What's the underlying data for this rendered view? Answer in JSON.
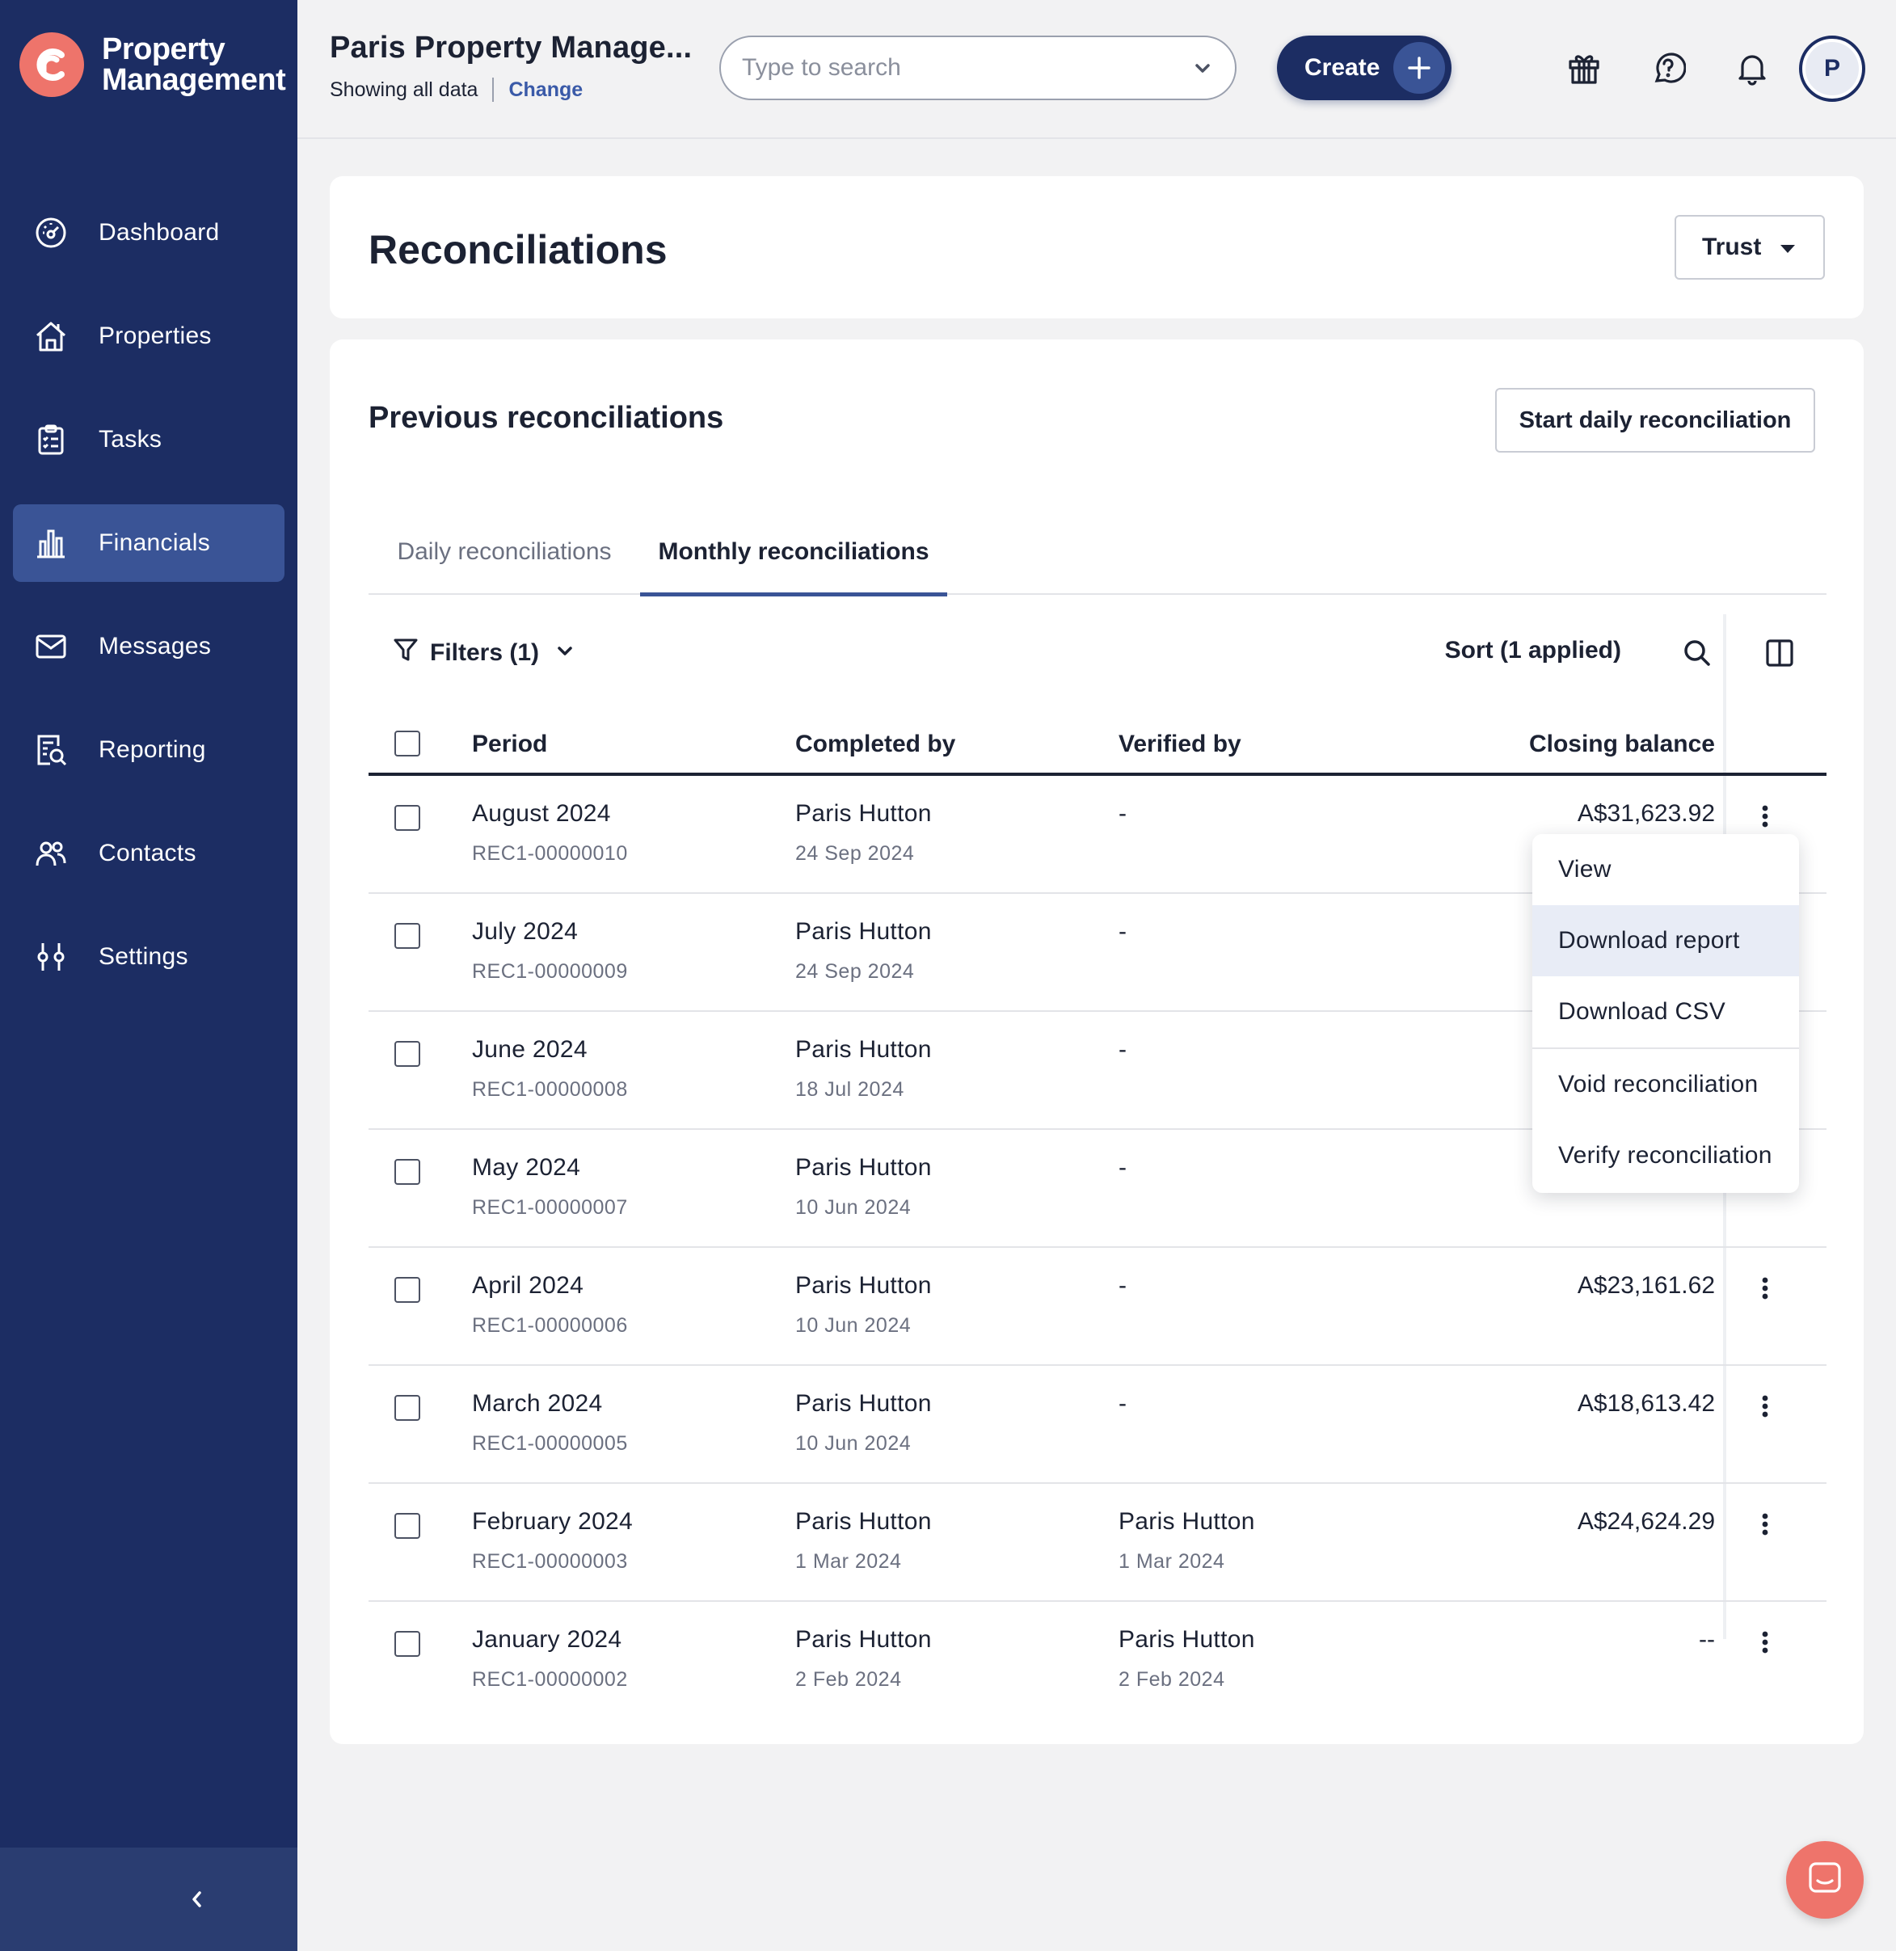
{
  "brand": {
    "line1": "Property",
    "line2": "Management"
  },
  "nav": [
    {
      "label": "Dashboard",
      "icon": "dashboard-icon"
    },
    {
      "label": "Properties",
      "icon": "home-icon"
    },
    {
      "label": "Tasks",
      "icon": "clipboard-icon"
    },
    {
      "label": "Financials",
      "icon": "financials-icon",
      "active": true
    },
    {
      "label": "Messages",
      "icon": "envelope-icon"
    },
    {
      "label": "Reporting",
      "icon": "report-search-icon"
    },
    {
      "label": "Contacts",
      "icon": "users-icon"
    },
    {
      "label": "Settings",
      "icon": "sliders-icon"
    }
  ],
  "header": {
    "org_title": "Paris Property Manage...",
    "showing": "Showing all data",
    "change": "Change",
    "search_placeholder": "Type to search",
    "create": "Create",
    "avatar_initial": "P"
  },
  "page": {
    "title": "Reconciliations",
    "trust": "Trust",
    "section_title": "Previous reconciliations",
    "start_button": "Start daily reconciliation",
    "tabs": [
      "Daily reconciliations",
      "Monthly reconciliations"
    ],
    "filters": "Filters (1)",
    "sort": "Sort (1 applied)"
  },
  "table": {
    "columns": [
      "Period",
      "Completed by",
      "Verified by",
      "Closing balance"
    ],
    "rows": [
      {
        "period": "August 2024",
        "ref": "REC1-00000010",
        "completed_by": "Paris Hutton",
        "completed_date": "24 Sep 2024",
        "verified_by": "-",
        "verified_date": "",
        "balance": "A$31,623.92"
      },
      {
        "period": "July 2024",
        "ref": "REC1-00000009",
        "completed_by": "Paris Hutton",
        "completed_date": "24 Sep 2024",
        "verified_by": "-",
        "verified_date": "",
        "balance": ""
      },
      {
        "period": "June 2024",
        "ref": "REC1-00000008",
        "completed_by": "Paris Hutton",
        "completed_date": "18 Jul 2024",
        "verified_by": "-",
        "verified_date": "",
        "balance": ""
      },
      {
        "period": "May 2024",
        "ref": "REC1-00000007",
        "completed_by": "Paris Hutton",
        "completed_date": "10 Jun 2024",
        "verified_by": "-",
        "verified_date": "",
        "balance": ""
      },
      {
        "period": "April 2024",
        "ref": "REC1-00000006",
        "completed_by": "Paris Hutton",
        "completed_date": "10 Jun 2024",
        "verified_by": "-",
        "verified_date": "",
        "balance": "A$23,161.62"
      },
      {
        "period": "March 2024",
        "ref": "REC1-00000005",
        "completed_by": "Paris Hutton",
        "completed_date": "10 Jun 2024",
        "verified_by": "-",
        "verified_date": "",
        "balance": "A$18,613.42"
      },
      {
        "period": "February 2024",
        "ref": "REC1-00000003",
        "completed_by": "Paris Hutton",
        "completed_date": "1 Mar 2024",
        "verified_by": "Paris Hutton",
        "verified_date": "1 Mar 2024",
        "balance": "A$24,624.29"
      },
      {
        "period": "January 2024",
        "ref": "REC1-00000002",
        "completed_by": "Paris Hutton",
        "completed_date": "2 Feb 2024",
        "verified_by": "Paris Hutton",
        "verified_date": "2 Feb 2024",
        "balance": "--"
      }
    ]
  },
  "menu": {
    "items": [
      "View",
      "Download report",
      "Download CSV",
      "Void reconciliation",
      "Verify reconciliation"
    ],
    "highlighted": "Download report"
  },
  "colors": {
    "sidebar": "#1c2d63",
    "sidebar_active": "#3a5496",
    "accent": "#ee746b",
    "link": "#3a5aa8"
  }
}
